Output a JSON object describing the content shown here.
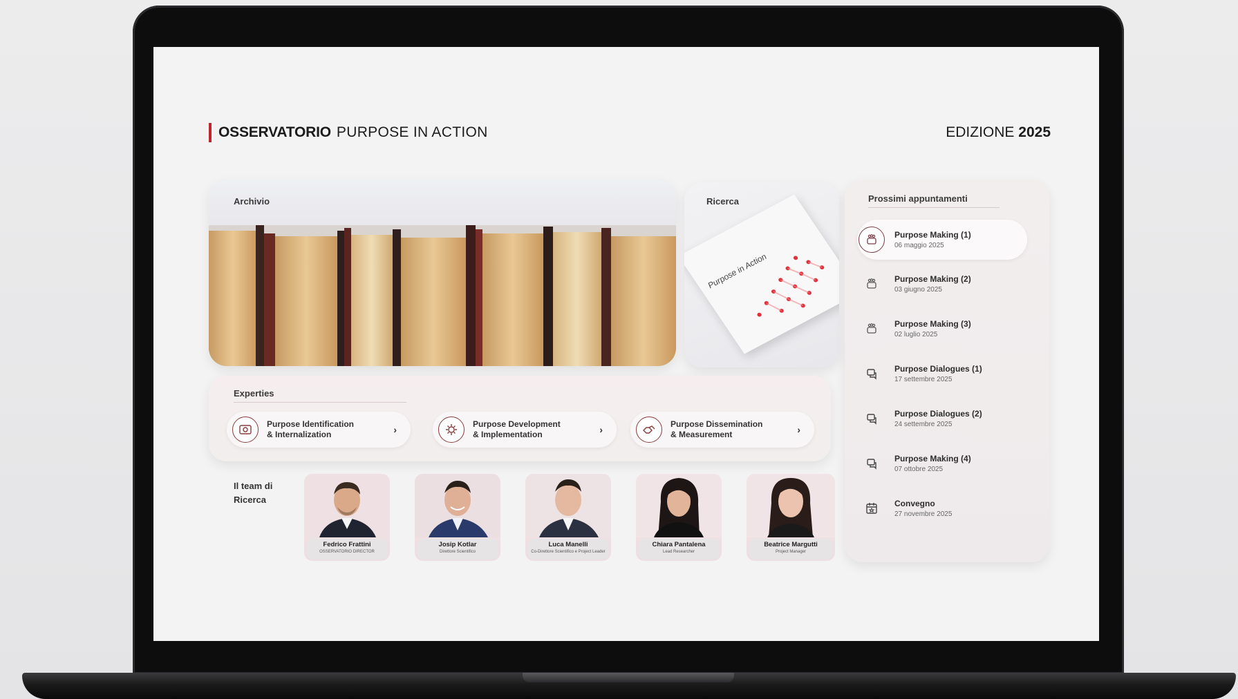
{
  "header": {
    "brand_strong": "OSSERVATORIO",
    "brand_light": "PURPOSE IN ACTION",
    "edition_label": "EDIZIONE",
    "edition_year": "2025"
  },
  "archivio": {
    "title": "Archivio"
  },
  "ricerca": {
    "title": "Ricerca",
    "doc_title": "Purpose in Action"
  },
  "experties": {
    "title": "Experties",
    "items": [
      {
        "line1": "Purpose Identification",
        "line2": "& Internalization",
        "icon": "target-icon"
      },
      {
        "line1": "Purpose Development",
        "line2": "& Implementation",
        "icon": "gear-icon"
      },
      {
        "line1": "Purpose Dissemination",
        "line2": "& Measurement",
        "icon": "handshake-icon"
      }
    ]
  },
  "team": {
    "title_line1": "Il team di",
    "title_line2": "Ricerca",
    "members": [
      {
        "name": "Fedrico Frattini",
        "role": "OSSERVATORIO DIRECTOR"
      },
      {
        "name": "Josip Kotlar",
        "role": "Direttore Scientifico"
      },
      {
        "name": "Luca Manelli",
        "role": "Co-Direttore Scientifico e Project Leader"
      },
      {
        "name": "Chiara Pantalena",
        "role": "Lead Researcher"
      },
      {
        "name": "Beatrice Margutti",
        "role": "Project Manager"
      }
    ]
  },
  "appuntamenti": {
    "title": "Prossimi appuntamenti",
    "items": [
      {
        "title": "Purpose Making (1)",
        "date": "06 maggio 2025",
        "icon": "group-icon",
        "active": true
      },
      {
        "title": "Purpose Making (2)",
        "date": "03 giugno 2025",
        "icon": "group-icon",
        "active": false
      },
      {
        "title": "Purpose Making (3)",
        "date": "02 luglio 2025",
        "icon": "group-icon",
        "active": false
      },
      {
        "title": "Purpose Dialogues (1)",
        "date": "17 settembre 2025",
        "icon": "chat-icon",
        "active": false
      },
      {
        "title": "Purpose Dialogues (2)",
        "date": "24 settembre 2025",
        "icon": "chat-icon",
        "active": false
      },
      {
        "title": "Purpose Making (4)",
        "date": "07 ottobre 2025",
        "icon": "chat-icon",
        "active": false
      },
      {
        "title": "Convegno",
        "date": "27 novembre 2025",
        "icon": "calendar-icon",
        "active": false
      }
    ]
  },
  "colors": {
    "accent": "#c0262d",
    "icon_stroke": "#7a3b46"
  }
}
